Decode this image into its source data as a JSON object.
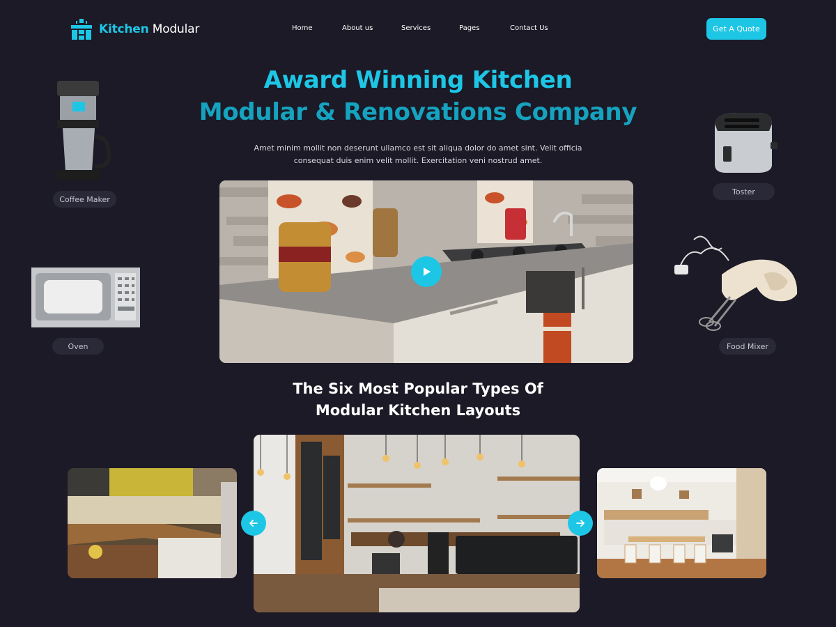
{
  "brand": {
    "name_part1": "Kitchen",
    "name_part2": "Modular",
    "logo_icon": "kitchen-cabinet-icon",
    "accent_color": "#1ec6e6",
    "background_color": "#1b1a26"
  },
  "nav": {
    "items": [
      {
        "label": "Home"
      },
      {
        "label": "About us"
      },
      {
        "label": "Services"
      },
      {
        "label": "Pages"
      },
      {
        "label": "Contact Us"
      }
    ]
  },
  "header": {
    "cta_label": "Get A Quote"
  },
  "hero": {
    "title_line1": "Award Winning Kitchen",
    "title_line2": "Modular & Renovations Company",
    "subtitle": "Amet minim mollit non deserunt ullamco est sit aliqua dolor do amet sint. Velit officia consequat duis enim velit mollit. Exercitation veni nostrud amet.",
    "play_icon": "play-icon"
  },
  "products": [
    {
      "label": "Coffee Maker",
      "icon": "coffee-maker-image"
    },
    {
      "label": "Toster",
      "icon": "toaster-image"
    },
    {
      "label": "Oven",
      "icon": "microwave-oven-image"
    },
    {
      "label": "Food Mixer",
      "icon": "hand-mixer-image"
    }
  ],
  "layouts": {
    "title": "The Six Most Popular Types Of Modular Kitchen Layouts",
    "prev_icon": "arrow-left-icon",
    "next_icon": "arrow-right-icon"
  }
}
